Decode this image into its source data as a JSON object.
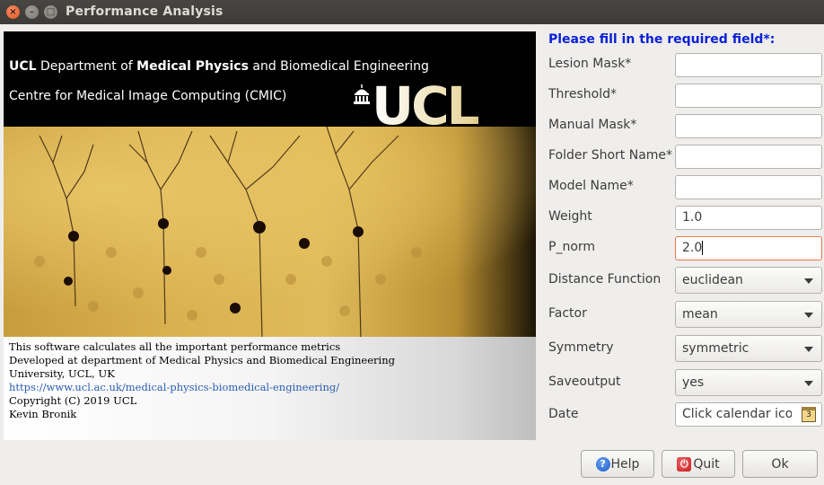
{
  "window": {
    "title": "Performance Analysis",
    "close_glyph": "×",
    "min_glyph": "–",
    "max_glyph": "□"
  },
  "banner": {
    "line1_strong": "UCL",
    "line1_a": " Department of ",
    "line1_strong2": "Medical Physics",
    "line1_b": " and Biomedical Engineering",
    "line2": "Centre for Medical Image Computing (CMIC)",
    "logo": "UCL",
    "info": [
      "This software calculates all the important performance metrics",
      "Developed at department of Medical Physics and Biomedical Engineering",
      "University, UCL, UK",
      "https://www.ucl.ac.uk/medical-physics-biomedical-engineering/",
      "Copyright (C) 2019 UCL",
      "Kevin Bronik"
    ]
  },
  "form": {
    "heading": "Please fill in the required field*:",
    "fields": [
      {
        "label": "Lesion Mask*",
        "value": ""
      },
      {
        "label": "Threshold*",
        "value": ""
      },
      {
        "label": "Manual Mask*",
        "value": ""
      },
      {
        "label": "Folder Short Name*",
        "value": ""
      },
      {
        "label": "Model Name*",
        "value": ""
      },
      {
        "label": "Weight",
        "value": "1.0"
      },
      {
        "label": "P_norm",
        "value": "2.0"
      }
    ],
    "combos": [
      {
        "label": "Distance Function",
        "value": "euclidean"
      },
      {
        "label": "Factor",
        "value": "mean"
      },
      {
        "label": "Symmetry",
        "value": "symmetric"
      },
      {
        "label": "Saveoutput",
        "value": "yes"
      }
    ],
    "date": {
      "label": "Date",
      "value": "Click calendar icon",
      "icon_text": "3"
    }
  },
  "buttons": {
    "help": "Help",
    "help_icon": "?",
    "quit": "Quit",
    "quit_icon": "⏻",
    "ok": "Ok"
  },
  "colors": {
    "heading": "#0b20d6",
    "active_border": "#e9784a",
    "link": "#2a5db0"
  }
}
